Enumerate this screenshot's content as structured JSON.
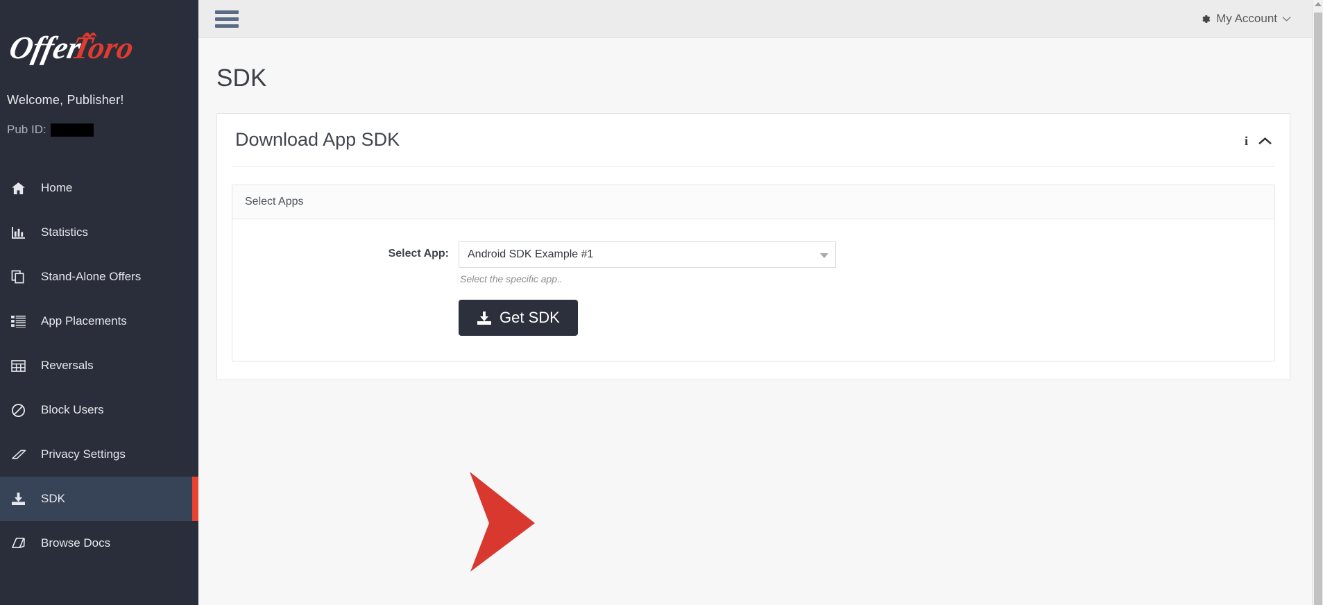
{
  "brand": {
    "logo_text_primary": "Offer",
    "logo_text_accent": "Toro",
    "accent_color": "#e03b2f",
    "sidebar_bg": "#2a2e3a",
    "sidebar_active_bg": "#374357",
    "active_marker_color": "#e8412f",
    "button_bg": "#2b303c",
    "arrow_color": "#d8382e"
  },
  "sidebar": {
    "welcome": "Welcome, Publisher!",
    "pub_id_label": "Pub ID:",
    "pub_id_value": "",
    "items": [
      {
        "label": "Home",
        "icon": "home-icon",
        "active": false
      },
      {
        "label": "Statistics",
        "icon": "bar-chart-icon",
        "active": false
      },
      {
        "label": "Stand-Alone Offers",
        "icon": "copy-icon",
        "active": false
      },
      {
        "label": "App Placements",
        "icon": "list-icon",
        "active": false
      },
      {
        "label": "Reversals",
        "icon": "table-icon",
        "active": false
      },
      {
        "label": "Block Users",
        "icon": "ban-icon",
        "active": false
      },
      {
        "label": "Privacy Settings",
        "icon": "eraser-icon",
        "active": false
      },
      {
        "label": "SDK",
        "icon": "download-icon",
        "active": true
      },
      {
        "label": "Browse Docs",
        "icon": "book-icon",
        "active": false
      }
    ]
  },
  "topbar": {
    "menu_toggle": "hamburger-icon",
    "account_label": "My Account",
    "account_icon": "gear-icon",
    "account_caret": "chevron-down-icon"
  },
  "page": {
    "title": "SDK"
  },
  "panel": {
    "title": "Download App SDK",
    "info_icon": "info-icon",
    "collapse_icon": "chevron-up-icon",
    "subpanel": {
      "header": "Select Apps",
      "form": {
        "select_app_label": "Select App:",
        "select_app_value": "Android SDK Example #1",
        "select_app_options": [
          "Android SDK Example #1"
        ],
        "select_app_help": "Select the specific app..",
        "select_caret": "caret-down-icon"
      },
      "submit_button": {
        "label": "Get SDK",
        "icon": "download-icon"
      }
    }
  },
  "annotation": {
    "type": "arrow",
    "points_to": "Get SDK"
  },
  "scrollbar": {
    "up_arrow": "scroll-up-arrow-icon"
  }
}
